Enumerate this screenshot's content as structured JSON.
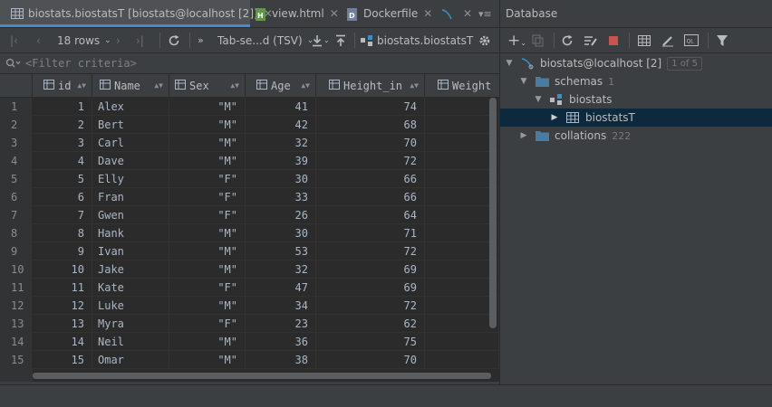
{
  "tabs": [
    {
      "label": "biostats.biostatsT [biostats@localhost [2]]",
      "icon": "table-icon",
      "active": true
    },
    {
      "label": "view.html",
      "icon": "html-file-icon",
      "active": false
    },
    {
      "label": "Dockerfile",
      "icon": "dockerfile-icon",
      "active": false
    }
  ],
  "tab_overflow_label": "▾≡",
  "grid_toolbar": {
    "rows_label": "18 rows",
    "format_label": "Tab-se...d (TSV)",
    "source_label": "biostats.biostatsT"
  },
  "filter_placeholder": "<Filter criteria>",
  "columns": [
    "id",
    "Name",
    "Sex",
    "Age",
    "Height_in",
    "Weight"
  ],
  "rows": [
    {
      "n": "1",
      "id": "1",
      "name": "Alex",
      "sex": "\"M\"",
      "age": "41",
      "height": "74"
    },
    {
      "n": "2",
      "id": "2",
      "name": "Bert",
      "sex": "\"M\"",
      "age": "42",
      "height": "68"
    },
    {
      "n": "3",
      "id": "3",
      "name": "Carl",
      "sex": "\"M\"",
      "age": "32",
      "height": "70"
    },
    {
      "n": "4",
      "id": "4",
      "name": "Dave",
      "sex": "\"M\"",
      "age": "39",
      "height": "72"
    },
    {
      "n": "5",
      "id": "5",
      "name": "Elly",
      "sex": "\"F\"",
      "age": "30",
      "height": "66"
    },
    {
      "n": "6",
      "id": "6",
      "name": "Fran",
      "sex": "\"F\"",
      "age": "33",
      "height": "66"
    },
    {
      "n": "7",
      "id": "7",
      "name": "Gwen",
      "sex": "\"F\"",
      "age": "26",
      "height": "64"
    },
    {
      "n": "8",
      "id": "8",
      "name": "Hank",
      "sex": "\"M\"",
      "age": "30",
      "height": "71"
    },
    {
      "n": "9",
      "id": "9",
      "name": "Ivan",
      "sex": "\"M\"",
      "age": "53",
      "height": "72"
    },
    {
      "n": "10",
      "id": "10",
      "name": "Jake",
      "sex": "\"M\"",
      "age": "32",
      "height": "69"
    },
    {
      "n": "11",
      "id": "11",
      "name": "Kate",
      "sex": "\"F\"",
      "age": "47",
      "height": "69"
    },
    {
      "n": "12",
      "id": "12",
      "name": "Luke",
      "sex": "\"M\"",
      "age": "34",
      "height": "72"
    },
    {
      "n": "13",
      "id": "13",
      "name": "Myra",
      "sex": "\"F\"",
      "age": "23",
      "height": "62"
    },
    {
      "n": "14",
      "id": "14",
      "name": "Neil",
      "sex": "\"M\"",
      "age": "36",
      "height": "75"
    },
    {
      "n": "15",
      "id": "15",
      "name": "Omar",
      "sex": "\"M\"",
      "age": "38",
      "height": "70"
    }
  ],
  "database_panel": {
    "title": "Database",
    "tree": {
      "datasource": "biostats@localhost [2]",
      "datasource_badge": "1 of 5",
      "schemas_label": "schemas",
      "schemas_count": "1",
      "schema_name": "biostats",
      "table_name": "biostatsT",
      "collations_label": "collations",
      "collations_count": "222"
    }
  },
  "colors": {
    "background": "#3c3f41",
    "grid_background": "#2b2b2b",
    "selection": "#0d293e",
    "accent": "#4a88c7",
    "stop_red": "#c75450"
  }
}
